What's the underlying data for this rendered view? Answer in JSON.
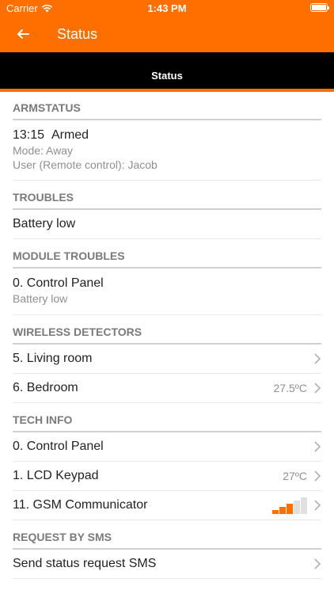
{
  "status_bar": {
    "carrier": "Carrier",
    "time": "1:43 PM"
  },
  "nav": {
    "title": "Status"
  },
  "tabs": [
    {
      "label": "Status",
      "selected": true
    }
  ],
  "colors": {
    "accent": "#ff6f00",
    "signal_on": "#ff6f00",
    "signal_off": "#e0e0e0"
  },
  "sections": {
    "armstatus": {
      "header": "ARMSTATUS",
      "time": "13:15",
      "state": "Armed",
      "mode": "Mode: Away",
      "user": "User (Remote control): Jacob"
    },
    "troubles": {
      "header": "TROUBLES",
      "items": [
        {
          "title": "Battery low"
        }
      ]
    },
    "module_troubles": {
      "header": "MODULE TROUBLES",
      "items": [
        {
          "title": "0. Control Panel",
          "subtitle": "Battery low"
        }
      ]
    },
    "wireless_detectors": {
      "header": "WIRELESS DETECTORS",
      "items": [
        {
          "title": "5. Living room",
          "value": ""
        },
        {
          "title": "6. Bedroom",
          "value": "27.5ºC"
        }
      ]
    },
    "tech_info": {
      "header": "TECH INFO",
      "items": [
        {
          "title": "0. Control Panel",
          "value": ""
        },
        {
          "title": "1. LCD Keypad",
          "value": "27ºC"
        },
        {
          "title": "11. GSM Communicator",
          "signal_bars": 3,
          "signal_max": 5
        }
      ]
    },
    "request_by_sms": {
      "header": "REQUEST BY SMS",
      "items": [
        {
          "title": "Send status request SMS"
        }
      ]
    }
  }
}
